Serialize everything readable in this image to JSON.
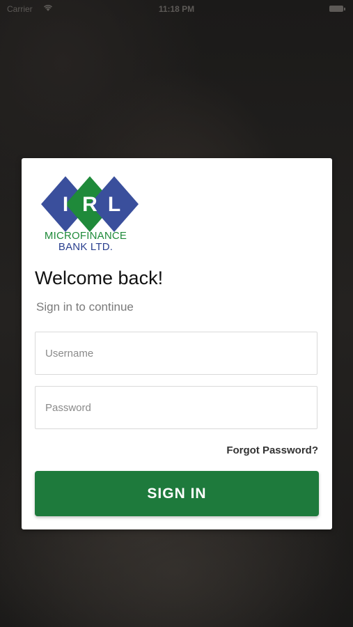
{
  "status_bar": {
    "carrier": "Carrier",
    "time": "11:18 PM",
    "wifi_icon": "wifi-icon",
    "battery_icon": "battery-icon"
  },
  "logo": {
    "letters": [
      "I",
      "R",
      "L"
    ],
    "line1": "MICROFINANCE",
    "line2": "BANK LTD.",
    "colors": {
      "blue": "#3a4f9c",
      "green": "#1f8a3a"
    }
  },
  "login": {
    "title": "Welcome back!",
    "subtitle": "Sign in to continue",
    "username_placeholder": "Username",
    "password_placeholder": "Password",
    "forgot_label": "Forgot Password?",
    "signin_label": "SIGN IN"
  },
  "colors": {
    "accent": "#1e7a3c",
    "card_bg": "#ffffff"
  }
}
